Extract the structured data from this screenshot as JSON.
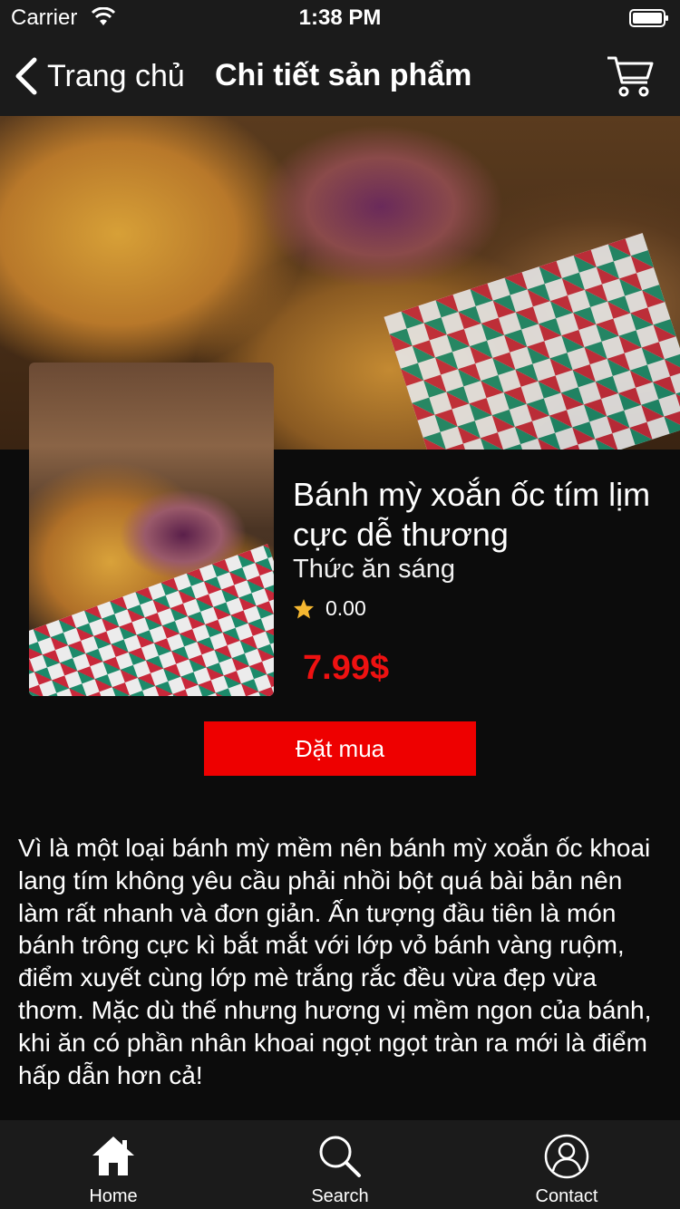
{
  "status_bar": {
    "carrier": "Carrier",
    "time": "1:38 PM"
  },
  "nav": {
    "back_label": "Trang chủ",
    "title": "Chi tiết sản phẩm",
    "cart_icon": "cart-icon"
  },
  "product": {
    "name": "Bánh mỳ xoắn ốc tím lịm cực dễ thương",
    "category": "Thức ăn sáng",
    "rating": "0.00",
    "price": "7.99$",
    "buy_label": "Đặt mua",
    "description": "Vì là một loại bánh mỳ mềm nên bánh mỳ xoắn ốc khoai lang tím không yêu cầu phải nhồi bột quá bài bản nên làm rất nhanh và đơn giản. Ấn tượng đầu tiên là món bánh trông cực kì bắt mắt với lớp vỏ bánh vàng ruộm, điểm xuyết cùng lớp mè trắng rắc đều vừa đẹp vừa thơm. Mặc dù thế nhưng hương vị mềm ngon của bánh, khi ăn có phần nhân khoai ngọt ngọt tràn ra mới là điểm hấp dẫn hơn cả!"
  },
  "tabs": [
    {
      "label": "Home",
      "icon": "home-icon"
    },
    {
      "label": "Search",
      "icon": "search-icon"
    },
    {
      "label": "Contact",
      "icon": "contact-icon"
    }
  ],
  "colors": {
    "accent": "#EE0000",
    "price": "#EE1111",
    "bar": "#1B1B1B",
    "star": "#F5B731"
  }
}
